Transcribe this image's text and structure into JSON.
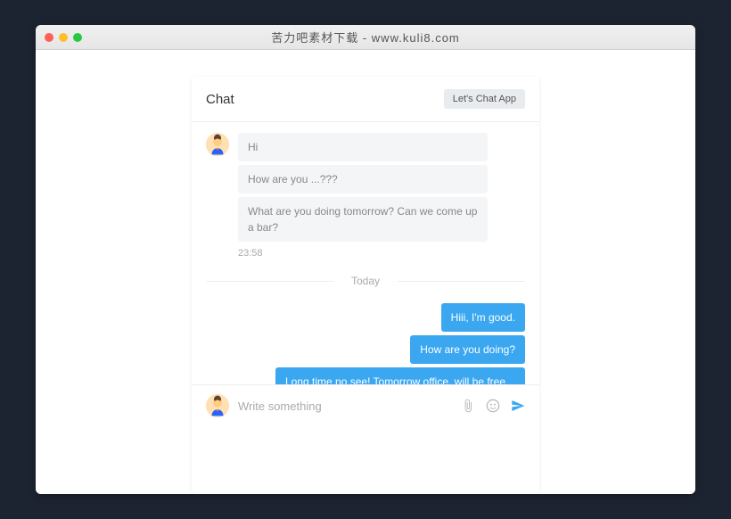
{
  "window": {
    "title": "苦力吧素材下载 - www.kuli8.com"
  },
  "chat": {
    "title": "Chat",
    "appButton": "Let's Chat App",
    "divider": "Today",
    "input": {
      "placeholder": "Write something"
    },
    "incoming": {
      "messages": [
        "Hi",
        "How are you ...???",
        "What are you doing tomorrow? Can we come up a bar?"
      ],
      "time": "23:58"
    },
    "outgoing": {
      "messages": [
        "Hiii, I'm good.",
        "How are you doing?",
        "Long time no see! Tomorrow office. will be free on sunday."
      ]
    }
  }
}
